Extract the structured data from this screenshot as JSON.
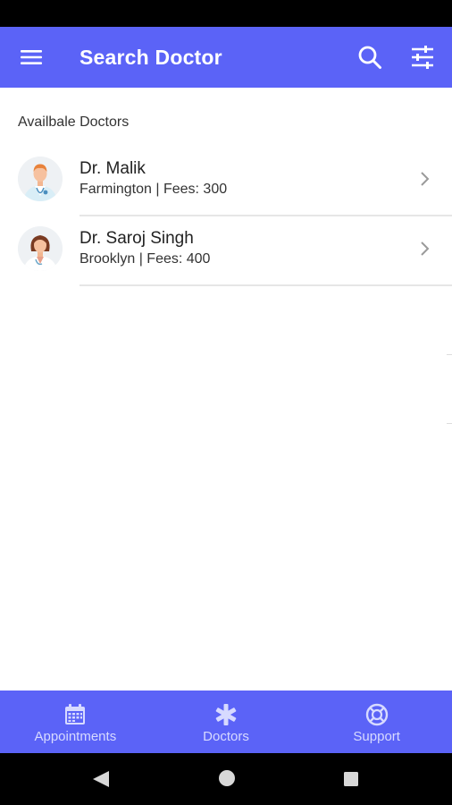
{
  "app_bar": {
    "title": "Search Doctor",
    "menu_icon": "hamburger-menu-icon",
    "search_icon": "search-icon",
    "filter_icon": "tune-sliders-icon",
    "background": "#5b63f7"
  },
  "section_title": "Availbale Doctors",
  "doctors": [
    {
      "name": "Dr. Malik",
      "details": "Farmington | Fees: 300",
      "avatar": "male-doctor-avatar"
    },
    {
      "name": "Dr. Saroj Singh",
      "details": "Brooklyn | Fees: 400",
      "avatar": "female-doctor-avatar"
    }
  ],
  "bottom_nav": {
    "items": [
      {
        "label": "Appointments",
        "icon": "calendar-icon"
      },
      {
        "label": "Doctors",
        "icon": "asterisk-medical-icon"
      },
      {
        "label": "Support",
        "icon": "lifebuoy-support-icon"
      }
    ]
  }
}
